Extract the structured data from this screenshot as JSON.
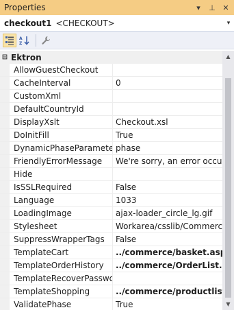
{
  "window": {
    "title": "Properties",
    "pin_glyph": "⊥",
    "close_glyph": "✕",
    "dropdown_glyph": "▾"
  },
  "object_selector": {
    "name": "checkout1",
    "type": "<CHECKOUT>"
  },
  "toolbar": {
    "buttons": [
      "categorized-icon",
      "alphabetical-icon",
      "properties-wrench-icon"
    ],
    "active": "categorized-icon"
  },
  "grid": {
    "category": {
      "label": "Ektron",
      "expander": "⊟"
    },
    "properties": [
      {
        "name": "AllowGuestCheckout",
        "value": "",
        "bold": false
      },
      {
        "name": "CacheInterval",
        "value": "0",
        "bold": false
      },
      {
        "name": "CustomXml",
        "value": "",
        "bold": false
      },
      {
        "name": "DefaultCountryId",
        "value": "",
        "bold": false
      },
      {
        "name": "DisplayXslt",
        "value": "Checkout.xsl",
        "bold": false
      },
      {
        "name": "DoInitFill",
        "value": "True",
        "bold": false
      },
      {
        "name": "DynamicPhaseParameter",
        "value": "phase",
        "bold": false
      },
      {
        "name": "FriendlyErrorMessage",
        "value": "We're sorry, an error occurred",
        "bold": false
      },
      {
        "name": "Hide",
        "value": "",
        "bold": false
      },
      {
        "name": "IsSSLRequired",
        "value": "False",
        "bold": false
      },
      {
        "name": "Language",
        "value": "1033",
        "bold": false
      },
      {
        "name": "LoadingImage",
        "value": "ajax-loader_circle_lg.gif",
        "bold": false
      },
      {
        "name": "Stylesheet",
        "value": "Workarea/csslib/Commerce/",
        "bold": false
      },
      {
        "name": "SuppressWrapperTags",
        "value": "False",
        "bold": false
      },
      {
        "name": "TemplateCart",
        "value": "../commerce/basket.aspx",
        "bold": true
      },
      {
        "name": "TemplateOrderHistory",
        "value": "../commerce/OrderList.aspx",
        "bold": true
      },
      {
        "name": "TemplateRecoverPassword",
        "value": "",
        "bold": false
      },
      {
        "name": "TemplateShopping",
        "value": "../commerce/productlist.asp",
        "bold": true
      },
      {
        "name": "ValidatePhase",
        "value": "True",
        "bold": false
      }
    ]
  },
  "scrollbar": {
    "up_glyph": "▲",
    "down_glyph": "▼"
  }
}
